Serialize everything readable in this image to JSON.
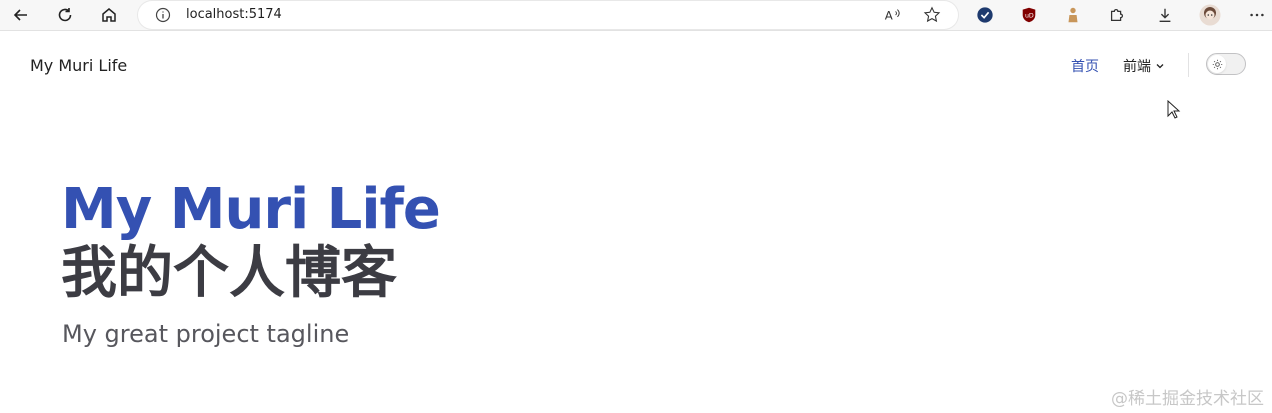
{
  "browser": {
    "url": "localhost:5174",
    "icons": [
      "back-arrow-icon",
      "refresh-icon",
      "home-icon",
      "info-icon",
      "read-aloud-icon",
      "favorite-star-icon",
      "shield-check-icon",
      "ublock-icon",
      "extension-figure-icon",
      "extensions-puzzle-icon",
      "download-icon",
      "profile-avatar-icon",
      "more-options-icon"
    ]
  },
  "site": {
    "title": "My Muri Life",
    "nav": {
      "home_label": "首页",
      "frontend_label": "前端"
    },
    "accent_color": "#3451b2"
  },
  "hero": {
    "name": "My Muri Life",
    "text": "我的个人博客",
    "tagline": "My great project tagline"
  },
  "watermark": "@稀土掘金技术社区"
}
